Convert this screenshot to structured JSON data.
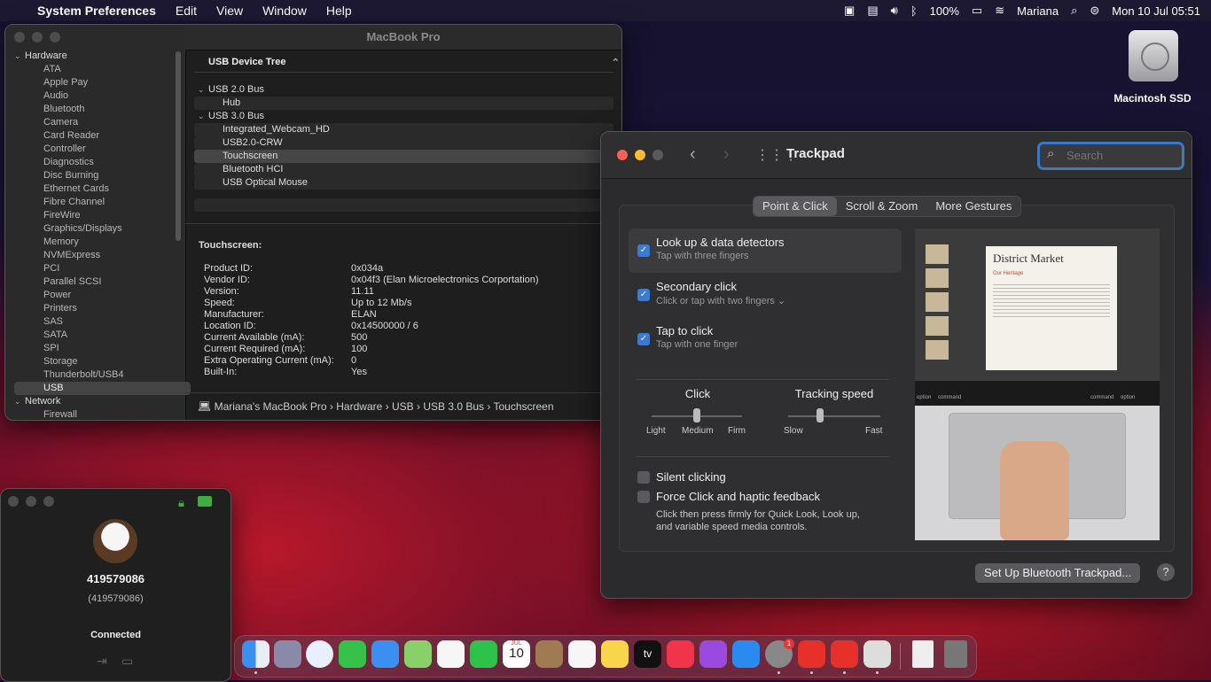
{
  "menubar": {
    "app_name": "System Preferences",
    "menus": [
      "Edit",
      "View",
      "Window",
      "Help"
    ],
    "battery": "100%",
    "user": "Mariana",
    "datetime": "Mon 10 Jul  05:51"
  },
  "desktop": {
    "drive_label": "Macintosh SSD"
  },
  "sysinfo": {
    "title": "MacBook Pro",
    "sidebar": {
      "hardware_label": "Hardware",
      "hardware_items": [
        "ATA",
        "Apple Pay",
        "Audio",
        "Bluetooth",
        "Camera",
        "Card Reader",
        "Controller",
        "Diagnostics",
        "Disc Burning",
        "Ethernet Cards",
        "Fibre Channel",
        "FireWire",
        "Graphics/Displays",
        "Memory",
        "NVMExpress",
        "PCI",
        "Parallel SCSI",
        "Power",
        "Printers",
        "SAS",
        "SATA",
        "SPI",
        "Storage",
        "Thunderbolt/USB4",
        "USB"
      ],
      "selected_item": "USB",
      "network_label": "Network",
      "network_items": [
        "Firewall"
      ]
    },
    "usb_tree": {
      "header": "USB Device Tree",
      "bus1": "USB 2.0 Bus",
      "bus1_children": [
        "Hub"
      ],
      "bus2": "USB 3.0 Bus",
      "bus2_children": [
        "Integrated_Webcam_HD",
        "USB2.0-CRW",
        "Touchscreen",
        "Bluetooth HCI",
        "USB Optical Mouse"
      ],
      "selected": "Touchscreen"
    },
    "details": {
      "title": "Touchscreen:",
      "rows": [
        {
          "k": "Product ID:",
          "v": "0x034a"
        },
        {
          "k": "Vendor ID:",
          "v": "0x04f3  (Elan Microelectronics Corportation)"
        },
        {
          "k": "Version:",
          "v": "11.11"
        },
        {
          "k": "Speed:",
          "v": "Up to 12 Mb/s"
        },
        {
          "k": "Manufacturer:",
          "v": "ELAN"
        },
        {
          "k": "Location ID:",
          "v": "0x14500000 / 6"
        },
        {
          "k": "Current Available (mA):",
          "v": "500"
        },
        {
          "k": "Current Required (mA):",
          "v": "100"
        },
        {
          "k": "Extra Operating Current (mA):",
          "v": "0"
        },
        {
          "k": "Built-In:",
          "v": "Yes"
        }
      ]
    },
    "path": [
      "Mariana's MacBook Pro",
      "Hardware",
      "USB",
      "USB 3.0 Bus",
      "Touchscreen"
    ]
  },
  "trackpad": {
    "title": "Trackpad",
    "search_placeholder": "Search",
    "tabs": [
      "Point & Click",
      "Scroll & Zoom",
      "More Gestures"
    ],
    "active_tab": "Point & Click",
    "options": [
      {
        "label": "Look up & data detectors",
        "sub": "Tap with three fingers",
        "checked": true
      },
      {
        "label": "Secondary click",
        "sub": "Click or tap with two fingers ⌄",
        "checked": true
      },
      {
        "label": "Tap to click",
        "sub": "Tap with one finger",
        "checked": true
      }
    ],
    "click": {
      "label": "Click",
      "marks": [
        "Light",
        "Medium",
        "Firm"
      ],
      "value": "Medium"
    },
    "tracking": {
      "label": "Tracking speed",
      "min": "Slow",
      "max": "Fast",
      "value_fraction": 0.35
    },
    "silent_clicking": {
      "label": "Silent clicking",
      "checked": false
    },
    "force_click": {
      "label": "Force Click and haptic feedback",
      "checked": false,
      "desc1": "Click then press firmly for Quick Look, Look up,",
      "desc2": "and variable speed media controls."
    },
    "preview_title": "District Market",
    "preview_heading": "Our Heritage",
    "preview_keys": [
      "option",
      "command",
      "command",
      "option"
    ],
    "setup_button": "Set Up Bluetooth Trackpad...",
    "help": "?"
  },
  "remote": {
    "id": "419579086",
    "id_paren": "(419579086)",
    "status": "Connected"
  },
  "dock": {
    "badge": "1",
    "calendar_month": "JUL",
    "calendar_day": "10",
    "tv_label": "tv"
  }
}
